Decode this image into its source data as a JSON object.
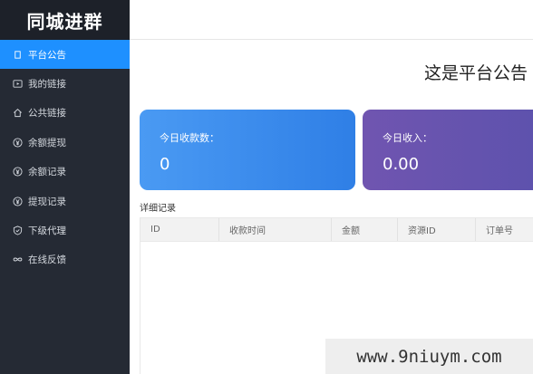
{
  "sidebar": {
    "logo": "同城进群",
    "items": [
      {
        "label": "平台公告",
        "icon": "square-outline-icon",
        "active": true
      },
      {
        "label": "我的链接",
        "icon": "play-box-icon",
        "active": false
      },
      {
        "label": "公共链接",
        "icon": "home-icon",
        "active": false
      },
      {
        "label": "余额提现",
        "icon": "yen-circle-icon",
        "active": false
      },
      {
        "label": "余额记录",
        "icon": "yen-circle-icon",
        "active": false
      },
      {
        "label": "提现记录",
        "icon": "yen-circle-icon",
        "active": false
      },
      {
        "label": "下级代理",
        "icon": "shield-check-icon",
        "active": false
      },
      {
        "label": "在线反馈",
        "icon": "infinity-icon",
        "active": false
      }
    ]
  },
  "main": {
    "headline": "这是平台公告",
    "cards": [
      {
        "label": "今日收款数：",
        "value": "0"
      },
      {
        "label": "今日收入：",
        "value": "0.00"
      }
    ],
    "section_title": "详细记录",
    "table": {
      "columns": [
        "ID",
        "收款时间",
        "金额",
        "资源ID",
        "订单号"
      ]
    }
  },
  "watermark": "www.9niuym.com",
  "colors": {
    "sidebar_bg": "#252a34",
    "active_blue": "#1e90ff",
    "card_blue": "#2f7fe6",
    "card_purple": "#6354ae"
  }
}
